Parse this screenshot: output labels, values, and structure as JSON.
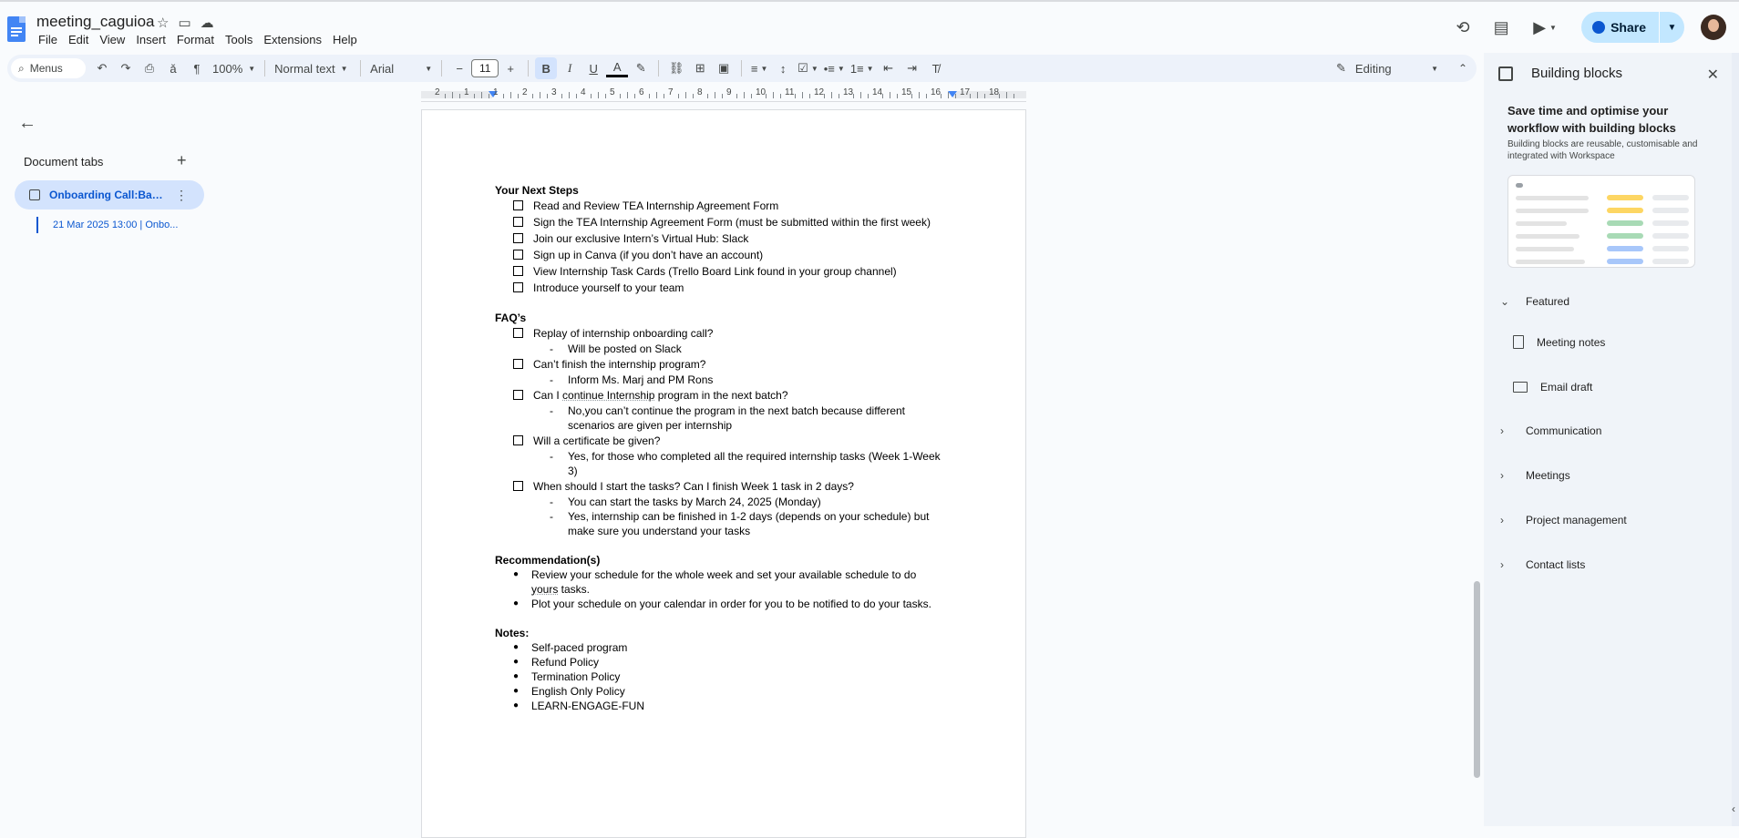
{
  "app": {
    "title": "meeting_caguioa",
    "menu": [
      "File",
      "Edit",
      "View",
      "Insert",
      "Format",
      "Tools",
      "Extensions",
      "Help"
    ],
    "share_label": "Share"
  },
  "toolbar": {
    "search_label": "Menus",
    "zoom": "100%",
    "style": "Normal text",
    "font": "Arial",
    "font_size": "11",
    "mode": "Editing"
  },
  "ruler": [
    "2",
    "1",
    "1",
    "2",
    "3",
    "4",
    "5",
    "6",
    "7",
    "8",
    "9",
    "10",
    "11",
    "12",
    "13",
    "14",
    "15",
    "16",
    "17",
    "18"
  ],
  "tabs": {
    "title": "Document tabs",
    "active": "Onboarding Call:Batc...",
    "subtab": "21 Mar 2025 13:00 | Onbo..."
  },
  "doc": {
    "next_steps_heading": "Your Next Steps",
    "next_steps": [
      "Read and Review TEA Internship Agreement Form",
      "Sign the TEA Internship Agreement Form (must be submitted within the first week)",
      "Join our exclusive Intern’s Virtual Hub: Slack",
      "Sign up in Canva (if you don’t have an account)",
      "View Internship Task Cards (Trello Board Link found in your group channel)",
      "Introduce yourself to your team"
    ],
    "faq_heading": "FAQ’s",
    "faq": [
      {
        "q": "Replay of internship onboarding call?",
        "a": [
          "Will be posted on Slack"
        ]
      },
      {
        "q": "Can’t finish the internship program?",
        "a": [
          "Inform Ms. Marj and PM Rons"
        ]
      },
      {
        "q_pre": "Can I ",
        "q_ul": "continue Internship",
        "q_post": " program in the next batch?",
        "a": [
          "No,you can’t continue the program in the next batch because different scenarios are given per internship"
        ]
      },
      {
        "q": "Will a certificate be given?",
        "a": [
          "Yes, for those who completed all the required internship tasks (Week 1-Week 3)"
        ]
      },
      {
        "q": "When should I start the tasks? Can I finish Week 1 task in 2 days?",
        "a": [
          "You can start the tasks by March 24, 2025 (Monday)",
          "Yes, internship can be finished in 1-2 days (depends on your schedule) but make sure you understand your tasks"
        ]
      }
    ],
    "reco_heading": "Recommendation(s)",
    "reco1_pre": "Review your schedule for the whole week and set your available schedule to do ",
    "reco1_ul": "yours",
    "reco1_post": " tasks.",
    "reco2": "Plot your schedule on your calendar in order for you to be notified to do your tasks.",
    "notes_heading": "Notes:",
    "notes": [
      "Self-paced program",
      "Refund Policy",
      "Termination Policy",
      "English Only Policy",
      "LEARN-ENGAGE-FUN"
    ]
  },
  "side": {
    "title": "Building blocks",
    "hero": "Save time and optimise your workflow with building blocks",
    "sub": "Building blocks are reusable, customisable and integrated with Workspace",
    "featured": "Featured",
    "templates": [
      "Meeting notes",
      "Email draft"
    ],
    "sections": [
      "Communication",
      "Meetings",
      "Project management",
      "Contact lists"
    ]
  },
  "colors": {
    "accent": "#0b57d0",
    "share_bg": "#c2e7ff",
    "toolbar_bg": "#edf2fa",
    "side_bg": "#f0f4f9"
  }
}
